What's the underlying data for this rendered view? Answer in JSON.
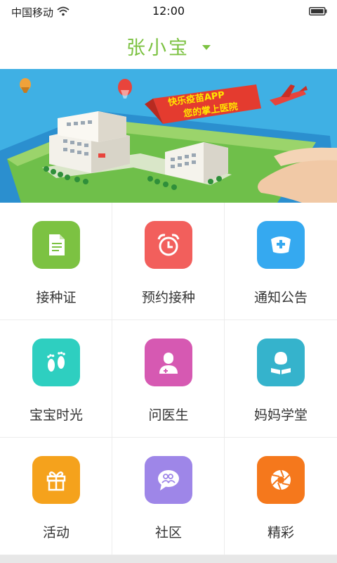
{
  "status_bar": {
    "carrier": "中国移动",
    "time": "12:00",
    "wifi_icon": "wifi-icon",
    "battery_icon": "battery-icon"
  },
  "header": {
    "child_name": "张小宝",
    "dropdown_icon": "chevron-down-icon",
    "accent_color": "#7cc242"
  },
  "banner": {
    "line1": "快乐疫苗APP",
    "line2": "您的掌上医院"
  },
  "menu": [
    {
      "label": "接种证",
      "icon": "document-icon",
      "color": "#7cc242"
    },
    {
      "label": "预约接种",
      "icon": "alarm-clock-icon",
      "color": "#f25f5c"
    },
    {
      "label": "通知公告",
      "icon": "nurse-cap-icon",
      "color": "#35a9f0"
    },
    {
      "label": "宝宝时光",
      "icon": "footprints-icon",
      "color": "#2ecfc0"
    },
    {
      "label": "问医生",
      "icon": "doctor-icon",
      "color": "#d659b2"
    },
    {
      "label": "妈妈学堂",
      "icon": "reading-mother-icon",
      "color": "#35b3cc"
    },
    {
      "label": "活动",
      "icon": "gift-icon",
      "color": "#f5a21c"
    },
    {
      "label": "社区",
      "icon": "chat-community-icon",
      "color": "#9e86e8"
    },
    {
      "label": "精彩",
      "icon": "aperture-icon",
      "color": "#f5781c"
    }
  ]
}
